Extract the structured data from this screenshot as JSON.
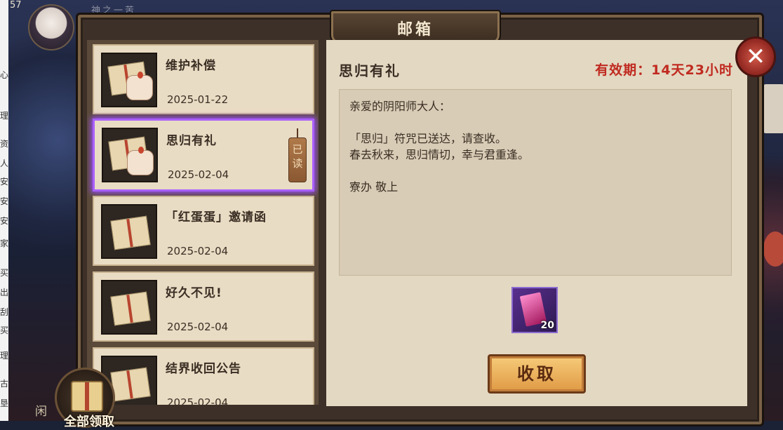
{
  "window": {
    "title": "邮箱"
  },
  "hud": {
    "level": "57",
    "top_text": "神之一苦"
  },
  "mail_list": [
    {
      "name": "维护补偿",
      "date": "2025-01-22",
      "read": false,
      "icon": "gift-parcel-icon"
    },
    {
      "name": "思归有礼",
      "date": "2025-02-04",
      "read": true,
      "read_label": "已读",
      "icon": "gift-parcel-icon"
    },
    {
      "name": "「红蛋蛋」邀请函",
      "date": "2025-02-04",
      "read": false,
      "icon": "envelope-icon"
    },
    {
      "name": "好久不见!",
      "date": "2025-02-04",
      "read": false,
      "icon": "envelope-icon"
    },
    {
      "name": "结界收回公告",
      "date": "2025-02-04",
      "read": false,
      "icon": "envelope-icon"
    }
  ],
  "detail": {
    "title": "思归有礼",
    "expiry": "有效期：14天23小时",
    "body": [
      "亲爱的阴阳师大人：",
      "",
      "「思归」符咒已送达，请查收。",
      "春去秋来，思归情切，幸与君重逢。",
      "",
      "寮办 敬上"
    ],
    "reward": {
      "icon": "talisman-icon",
      "count": "20"
    },
    "collect_label": "收取"
  },
  "claim_all": {
    "label": "全部领取"
  },
  "side_text": "闲",
  "browser_strip": [
    "心",
    "理",
    "资",
    "人",
    "安",
    "安",
    "安",
    "家",
    "买",
    "出",
    "刮",
    "买",
    "理",
    "古",
    "垦"
  ],
  "colors": {
    "accent_selected": "#a960ff",
    "expiry_red": "#c02a20",
    "button_gold": "#f6cc7a"
  }
}
